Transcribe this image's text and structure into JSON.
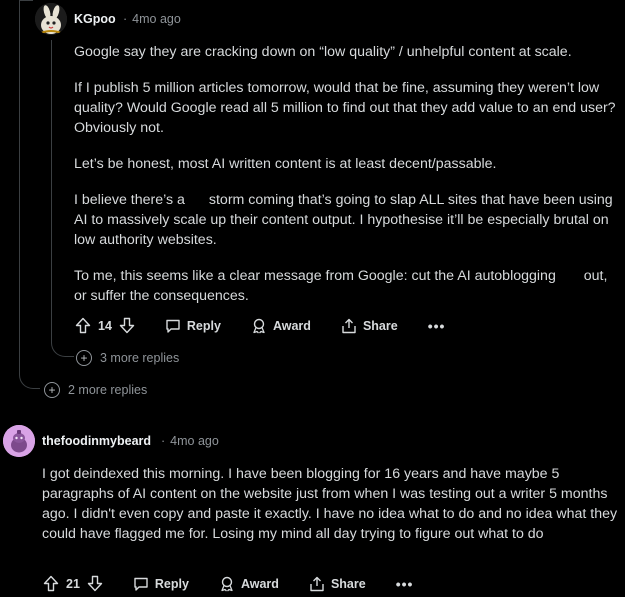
{
  "comment1": {
    "username": "KGpoo",
    "age": "4mo ago",
    "paragraphs": [
      [
        "Google say they are cracking down on “low quality” / unhelpful content at scale."
      ],
      [
        "If I publish 5 million articles tomorrow, would that be fine, assuming they weren’t low quality? Would Google read all 5 million to find out that they add value to an end user? Obviously not."
      ],
      [
        "Let’s be honest, most AI written content is at least decent/passable."
      ],
      [
        "I believe there’s a ",
        "storm coming that’s going to slap ALL sites that have been using AI to massively scale up their content output. I hypothesise it’ll be especially brutal on low authority websites."
      ],
      [
        "To me, this seems like a clear message from Google: cut the AI autoblogging ",
        " out, or suffer the consequences."
      ]
    ],
    "upvotes": "14",
    "reply_label": "Reply",
    "award_label": "Award",
    "share_label": "Share",
    "more_label": "•••",
    "more_replies": "3 more replies"
  },
  "parent_more_replies": "2 more replies",
  "comment2": {
    "username": "thefoodinmybeard",
    "age": "4mo ago",
    "paragraphs": [
      [
        "I got deindexed this morning. I have been blogging for 16 years and have maybe 5 paragraphs of AI content on the website just from when I was testing out a writer 5 months ago. I didn't even copy and paste it exactly. I have no idea what to do and no idea what they could have flagged me for. Losing my mind all day trying to figure out what to do"
      ]
    ],
    "upvotes": "21",
    "reply_label": "Reply",
    "award_label": "Award",
    "share_label": "Share",
    "more_label": "•••"
  },
  "icons": {
    "upvote": "arrow-up-icon",
    "downvote": "arrow-down-icon",
    "reply": "speech-bubble-icon",
    "award": "award-ribbon-icon",
    "share": "share-box-arrow-icon",
    "more": "ellipsis-icon",
    "expand": "plus-circle-icon"
  }
}
